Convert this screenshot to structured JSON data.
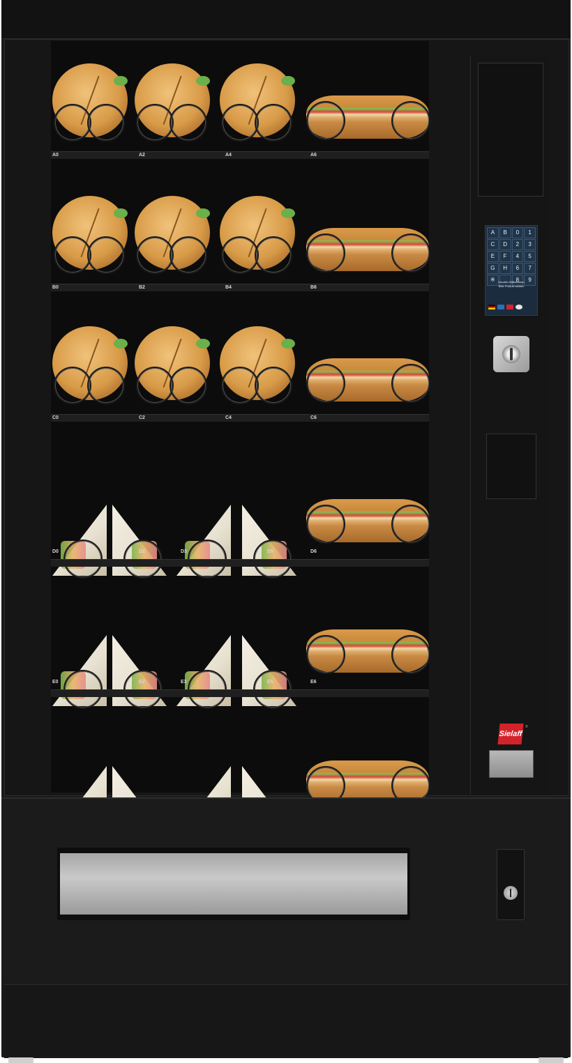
{
  "machine": {
    "brand_logo": "Sielaff",
    "brand_mark": "®"
  },
  "shelves": [
    {
      "row": "A",
      "labels": [
        "A0",
        "A2",
        "A4",
        "A6"
      ],
      "products": [
        "roll",
        "roll",
        "roll",
        "baguette"
      ]
    },
    {
      "row": "B",
      "labels": [
        "B0",
        "B2",
        "B4",
        "B6"
      ],
      "products": [
        "roll",
        "roll",
        "roll",
        "baguette"
      ]
    },
    {
      "row": "C",
      "labels": [
        "C0",
        "C2",
        "C4",
        "C6"
      ],
      "products": [
        "roll",
        "roll",
        "roll",
        "baguette"
      ]
    },
    {
      "row": "D",
      "labels": [
        "D0",
        "D2",
        "D3",
        "D5",
        "D6"
      ],
      "products": [
        "triangle",
        "triangle",
        "triangle",
        "triangle",
        "baguette"
      ]
    },
    {
      "row": "E",
      "labels": [
        "E0",
        "E2",
        "E3",
        "E5",
        "E6"
      ],
      "products": [
        "triangle",
        "triangle",
        "triangle",
        "triangle",
        "baguette"
      ]
    },
    {
      "row": "F",
      "labels": [],
      "products": [
        "triangle",
        "triangle",
        "triangle",
        "triangle",
        "baguette"
      ]
    }
  ],
  "display": {
    "keypad": [
      "A",
      "B",
      "0",
      "1",
      "C",
      "D",
      "2",
      "3",
      "E",
      "F",
      "4",
      "5",
      "G",
      "H",
      "6",
      "7",
      "※",
      "",
      "8",
      "9"
    ],
    "welcome_line1": "Herzlich Willkommen",
    "welcome_line2": "Bitte Produkt wählen",
    "icons": [
      "flag-de-icon",
      "info-icon",
      "sielaff-icon",
      "language-icon"
    ]
  },
  "colors": {
    "cabinet": "#1a1a1a",
    "screen": "#1b2c3e",
    "brand_red": "#d3232a",
    "steel": "#b0b0b0"
  }
}
